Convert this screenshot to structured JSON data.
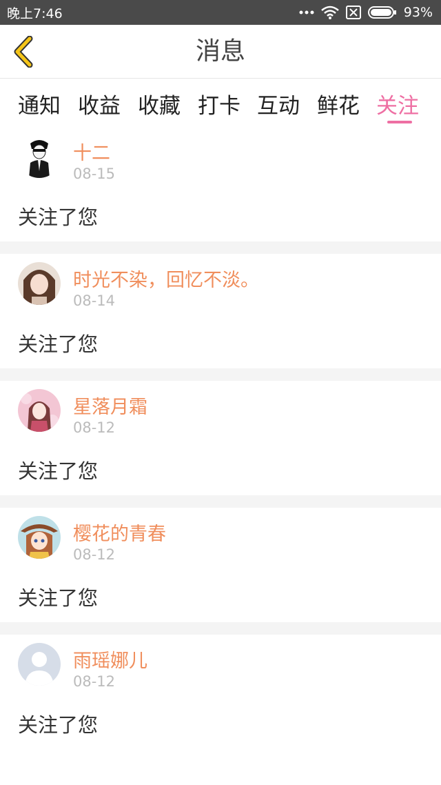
{
  "status_bar": {
    "time": "晚上7:46",
    "battery": "93%"
  },
  "header": {
    "title": "消息"
  },
  "tabs": [
    {
      "label": "通知"
    },
    {
      "label": "收益"
    },
    {
      "label": "收藏"
    },
    {
      "label": "打卡"
    },
    {
      "label": "互动"
    },
    {
      "label": "鲜花"
    },
    {
      "label": "关注"
    }
  ],
  "active_tab": "关注",
  "colors": {
    "accent_pink": "#ee6fa3",
    "username_orange": "#f08e5c",
    "date_gray": "#bbbbbb"
  },
  "messages": [
    {
      "name": "十二",
      "date": "08-15",
      "text": "关注了您",
      "avatar": "man-in-suit-avatar"
    },
    {
      "name": "时光不染，回忆不淡。",
      "date": "08-14",
      "text": "关注了您",
      "avatar": "girl-photo-avatar"
    },
    {
      "name": "星落月霜",
      "date": "08-12",
      "text": "关注了您",
      "avatar": "anime-girl-pink-avatar"
    },
    {
      "name": "樱花的青春",
      "date": "08-12",
      "text": "关注了您",
      "avatar": "anime-girl-hat-avatar"
    },
    {
      "name": "雨瑶娜儿",
      "date": "08-12",
      "text": "关注了您",
      "avatar": "default-person-avatar"
    }
  ]
}
